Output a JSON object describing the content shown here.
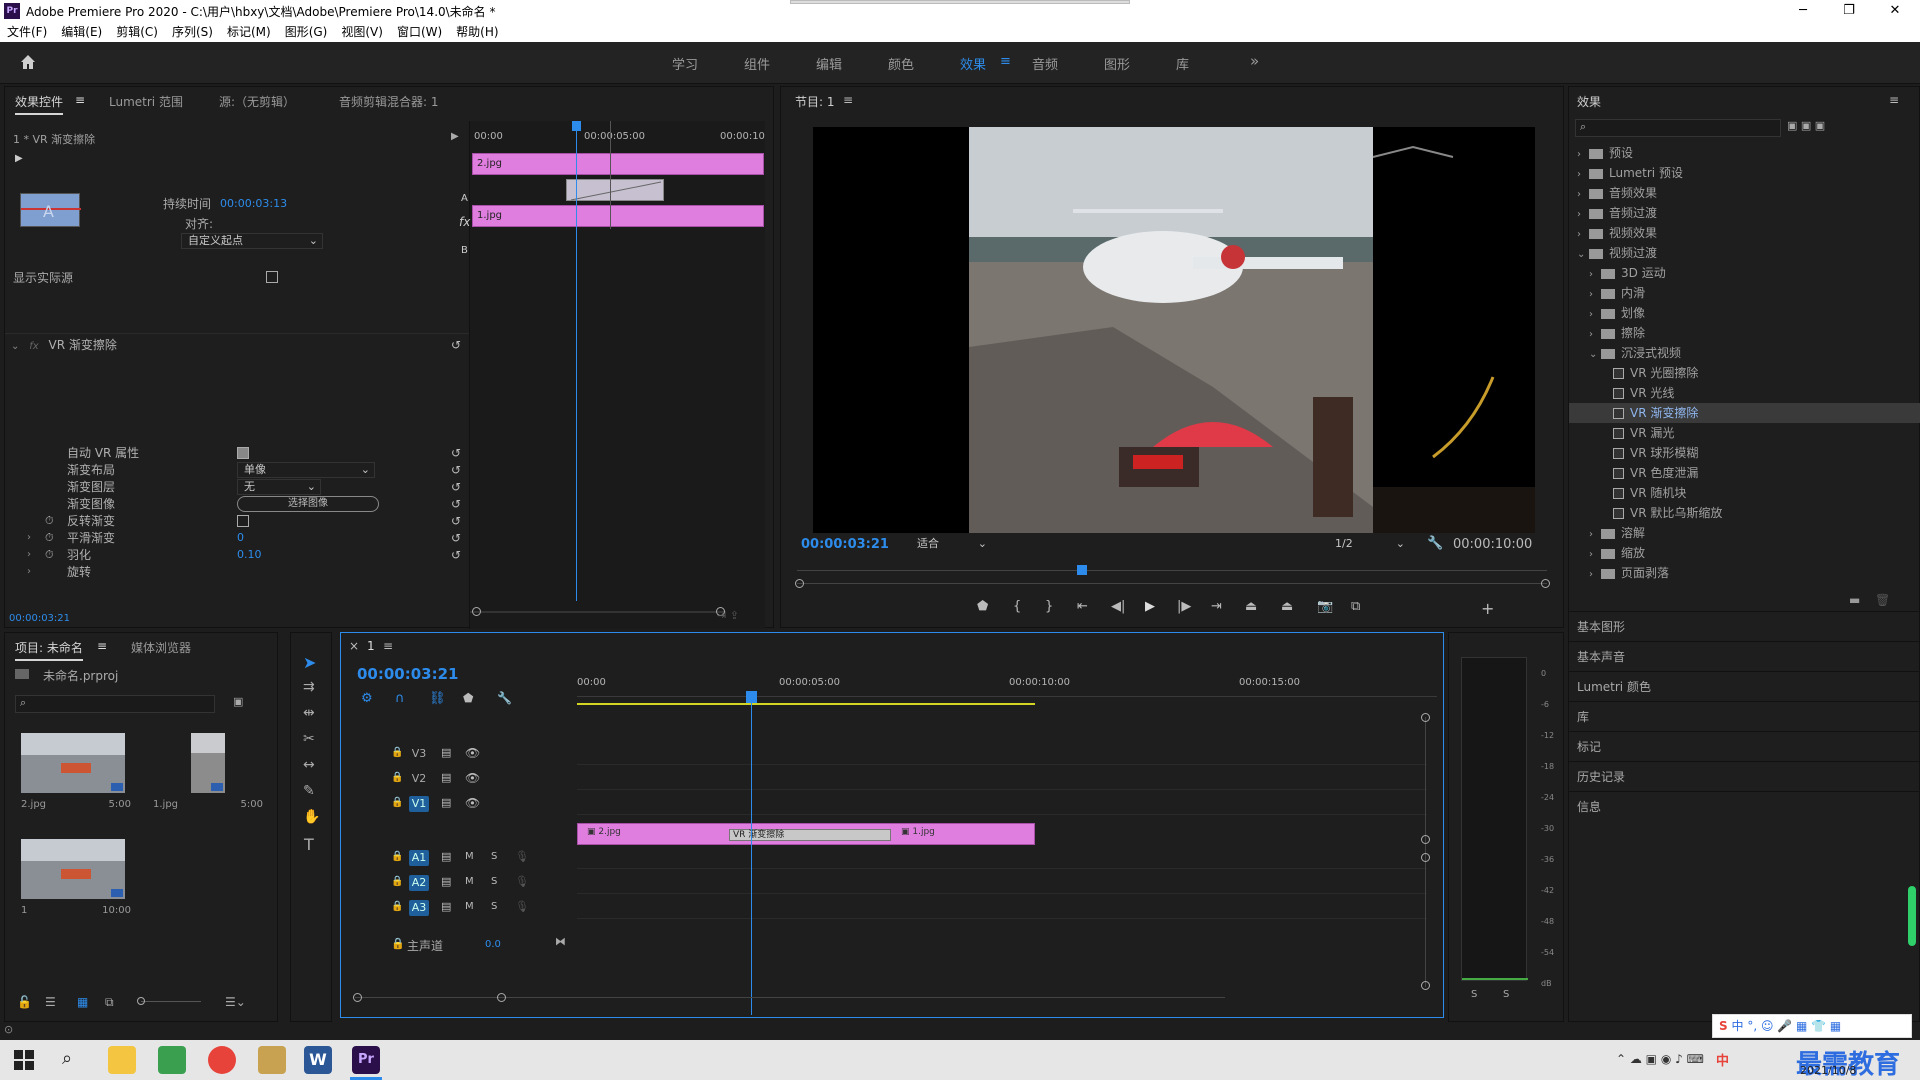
{
  "window": {
    "title": "Adobe Premiere Pro 2020 - C:\\用户\\hbxy\\文档\\Adobe\\Premiere Pro\\14.0\\未命名 *",
    "minimize": "─",
    "maximize": "❐",
    "close": "✕",
    "logo": "Pr"
  },
  "menu": [
    "文件(F)",
    "编辑(E)",
    "剪辑(C)",
    "序列(S)",
    "标记(M)",
    "图形(G)",
    "视图(V)",
    "窗口(W)",
    "帮助(H)"
  ],
  "workspaces": [
    "学习",
    "组件",
    "编辑",
    "颜色",
    "效果",
    "音频",
    "图形",
    "库"
  ],
  "workspace_active": "效果",
  "effect_controls": {
    "tabs": [
      "效果控件",
      "Lumetri 范围",
      "源:（无剪辑）",
      "音频剪辑混合器: 1"
    ],
    "clip_title": "1 * VR 渐变擦除",
    "ruler": [
      "00:00",
      "00:00:05:00",
      "00:00:10"
    ],
    "clip_a": "2.jpg",
    "clip_b": "1.jpg",
    "duration_label": "持续时间",
    "duration_value": "00:00:03:13",
    "align_label": "对齐:",
    "align_value": "自定义起点",
    "show_source": "显示实际源",
    "effect_name": "VR 渐变擦除",
    "props": [
      {
        "label": "自动 VR 属性",
        "type": "check",
        "checked": true
      },
      {
        "label": "渐变布局",
        "type": "select",
        "value": "单像"
      },
      {
        "label": "渐变图层",
        "type": "select",
        "value": "无"
      },
      {
        "label": "渐变图像",
        "type": "button",
        "value": "选择图像"
      },
      {
        "label": "反转渐变",
        "type": "check",
        "checked": false
      },
      {
        "label": "平滑渐变",
        "type": "number",
        "value": "0"
      },
      {
        "label": "羽化",
        "type": "number",
        "value": "0.10"
      },
      {
        "label": "旋转",
        "type": "none",
        "value": ""
      }
    ],
    "timecode": "00:00:03:21"
  },
  "program": {
    "title": "节目: 1",
    "timecode": "00:00:03:21",
    "fit": "适合",
    "resolution": "1/2",
    "duration": "00:00:10:00",
    "playhead_fraction": 0.38
  },
  "effects_panel": {
    "title": "效果",
    "tree": [
      {
        "label": "预设",
        "level": 0,
        "kind": "folder",
        "open": false
      },
      {
        "label": "Lumetri 预设",
        "level": 0,
        "kind": "folder",
        "open": false
      },
      {
        "label": "音频效果",
        "level": 0,
        "kind": "folder",
        "open": false
      },
      {
        "label": "音频过渡",
        "level": 0,
        "kind": "folder",
        "open": false
      },
      {
        "label": "视频效果",
        "level": 0,
        "kind": "folder",
        "open": false
      },
      {
        "label": "视频过渡",
        "level": 0,
        "kind": "folder",
        "open": true
      },
      {
        "label": "3D 运动",
        "level": 1,
        "kind": "folder",
        "open": false
      },
      {
        "label": "内滑",
        "level": 1,
        "kind": "folder",
        "open": false
      },
      {
        "label": "划像",
        "level": 1,
        "kind": "folder",
        "open": false
      },
      {
        "label": "擦除",
        "level": 1,
        "kind": "folder",
        "open": false
      },
      {
        "label": "沉浸式视频",
        "level": 1,
        "kind": "folder",
        "open": true
      },
      {
        "label": "VR 光圈擦除",
        "level": 2,
        "kind": "fx"
      },
      {
        "label": "VR 光线",
        "level": 2,
        "kind": "fx"
      },
      {
        "label": "VR 渐变擦除",
        "level": 2,
        "kind": "fx",
        "selected": true
      },
      {
        "label": "VR 漏光",
        "level": 2,
        "kind": "fx"
      },
      {
        "label": "VR 球形模糊",
        "level": 2,
        "kind": "fx"
      },
      {
        "label": "VR 色度泄漏",
        "level": 2,
        "kind": "fx"
      },
      {
        "label": "VR 随机块",
        "level": 2,
        "kind": "fx"
      },
      {
        "label": "VR 默比乌斯缩放",
        "level": 2,
        "kind": "fx"
      },
      {
        "label": "溶解",
        "level": 1,
        "kind": "folder",
        "open": false
      },
      {
        "label": "缩放",
        "level": 1,
        "kind": "folder",
        "open": false
      },
      {
        "label": "页面剥落",
        "level": 1,
        "kind": "folder",
        "open": false
      }
    ],
    "sections": [
      "基本图形",
      "基本声音",
      "Lumetri 颜色",
      "库",
      "标记",
      "历史记录",
      "信息"
    ]
  },
  "project": {
    "tabs": [
      "项目: 未命名",
      "媒体浏览器"
    ],
    "file": "未命名.prproj",
    "items": [
      {
        "name": "2.jpg",
        "duration": "5:00"
      },
      {
        "name": "1.jpg",
        "duration": "5:00"
      },
      {
        "name": "1",
        "duration": "10:00"
      }
    ]
  },
  "timeline": {
    "tab": "1",
    "timecode": "00:00:03:21",
    "ruler": [
      "00:00",
      "00:00:05:00",
      "00:00:10:00",
      "00:00:15:00"
    ],
    "video_tracks": [
      "V3",
      "V2",
      "V1"
    ],
    "audio_tracks": [
      "A1",
      "A2",
      "A3"
    ],
    "master_label": "主声道",
    "master_value": "0.0",
    "clip1": "2.jpg",
    "clip2": "1.jpg",
    "transition": "VR 渐变擦除",
    "mute": "M",
    "solo": "S"
  },
  "meter": {
    "ticks": [
      "0",
      "-6",
      "-12",
      "-18",
      "-24",
      "-30",
      "-36",
      "-42",
      "-48",
      "-54",
      "dB"
    ],
    "solo_left": "S",
    "solo_right": "S"
  },
  "tray": {
    "time": "",
    "date": "2021/10/8",
    "watermark": "最需教育",
    "ime": "中"
  }
}
